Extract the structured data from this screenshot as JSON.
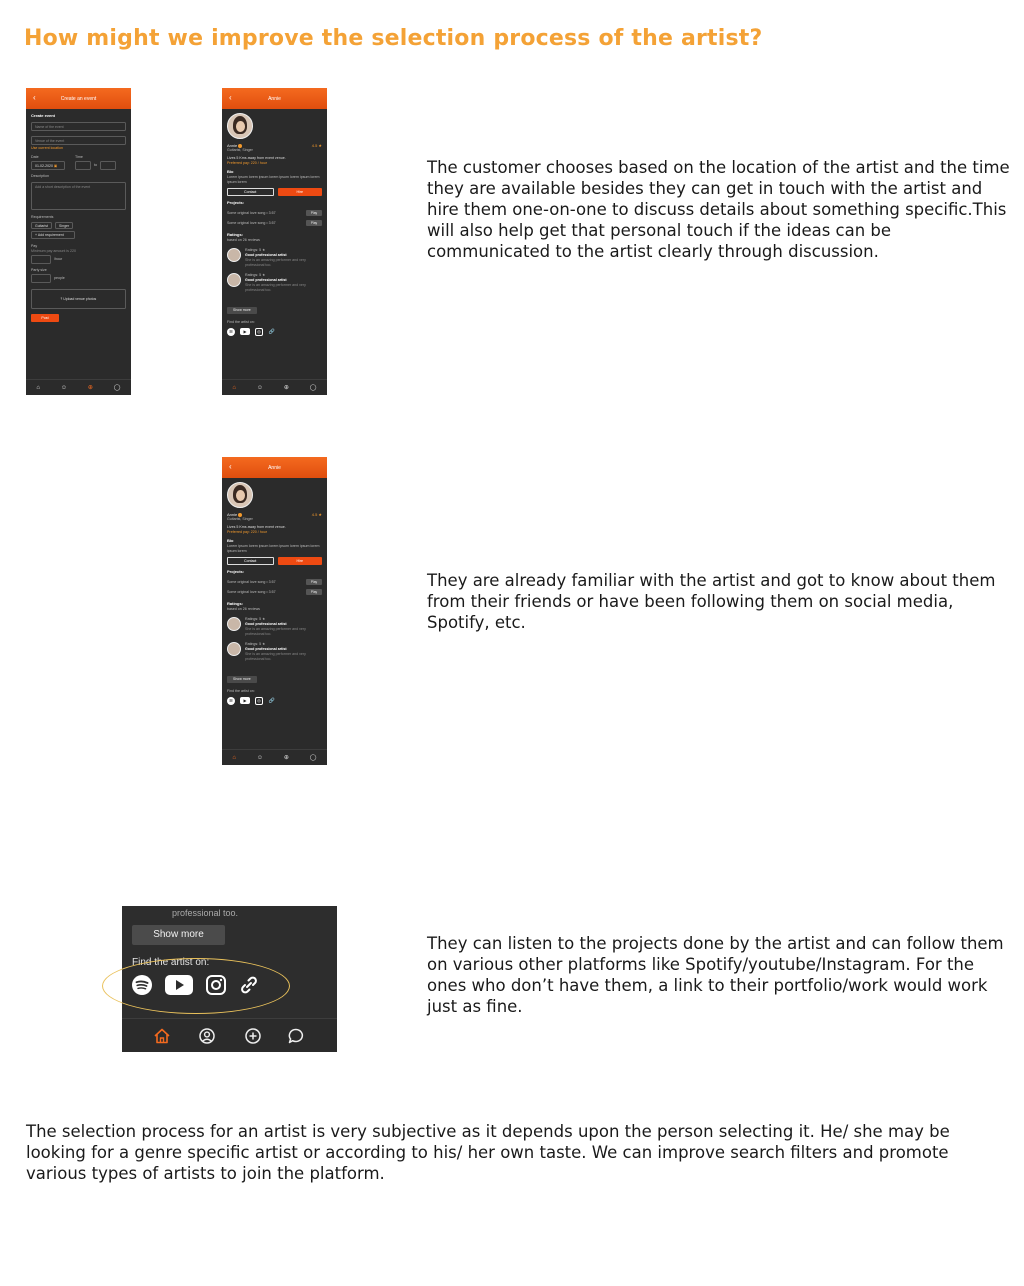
{
  "heading": "How might we improve the selection process of the artist?",
  "paragraphs": {
    "p1": "The customer chooses based on the location of the artist and the time they are available besides they can get in touch with the artist and hire them one-on-one to discuss details about something specific.This will also help get that personal touch if the ideas can be communicated to the artist clearly through discussion.",
    "p2": "They are already familiar with the artist and got to know about them from their friends or have been following them on social media, Spotify, etc.",
    "p3": "They can listen to the projects done by the artist and can follow them on various other platforms like Spotify/youtube/Instagram. For the ones who don’t have them, a link to their portfolio/work would work just as fine.",
    "p4": "The selection process for an artist is very subjective as it depends upon the person selecting it. He/ she may be looking for a genre specific artist or according to his/ her own taste. We can improve search filters and promote various types of artists to join the platform."
  },
  "create_event": {
    "title": "Create an event",
    "section": "Create event",
    "name_placeholder": "Name of the event",
    "venue_placeholder": "Venue of the event",
    "location_link": "Use current location",
    "date_label": "Date",
    "date_value": "01-02-2020",
    "time_label": "Time",
    "to_label": "to",
    "description_label": "Description",
    "description_placeholder": "Add a short description of the event",
    "requirements_label": "Requirements",
    "req_tags": [
      "Guitarist",
      "Singer"
    ],
    "add_requirement": "+ Add requirement",
    "pay_label": "Pay",
    "pay_hint": "Minimum pay amount is 220",
    "pay_unit": "/hour",
    "party_label": "Party size",
    "party_unit": "people",
    "upload_label": "Upload venue photos",
    "post_button": "Post"
  },
  "artist_profile": {
    "title": "Annie",
    "name": "Annie",
    "rating": "4.5 ★",
    "genre": "Guitarist, Singer",
    "distance": "Lives 5 Kms away from event venue.",
    "preferred_pay": "Preferred pay: 220 / hour",
    "bio_label": "Bio",
    "bio_text": "Lorem ipsum lorem ipsum lorem ipsum lorem ipsum lorem ipsum lorem",
    "contact_button": "Contact",
    "hire_button": "Hire",
    "projects_label": "Projects:",
    "projects": [
      {
        "title": "Some original love song • 3:57",
        "action": "Play"
      },
      {
        "title": "Some original love song • 3:57",
        "action": "Play"
      }
    ],
    "ratings_label": "Ratings:",
    "ratings_sub": "based on 26 reviews",
    "reviews": [
      {
        "rating": "Ratings: 5 ★",
        "headline": "Good professional artist",
        "body": "She is an amazing performer and very professional too."
      },
      {
        "rating": "Ratings: 5 ★",
        "headline": "Good professional artist",
        "body": "She is an amazing performer and very professional too."
      }
    ],
    "show_more": "Show more",
    "find_label": "Find the artist on:"
  },
  "crop": {
    "cut_text": "professional too.",
    "show_more": "Show more",
    "find_label": "Find the artist on:"
  },
  "colors": {
    "accent": "#f4a236",
    "orange_bar": "#f46a1f",
    "hire": "#ee4a12",
    "panel": "#2b2b2b"
  }
}
